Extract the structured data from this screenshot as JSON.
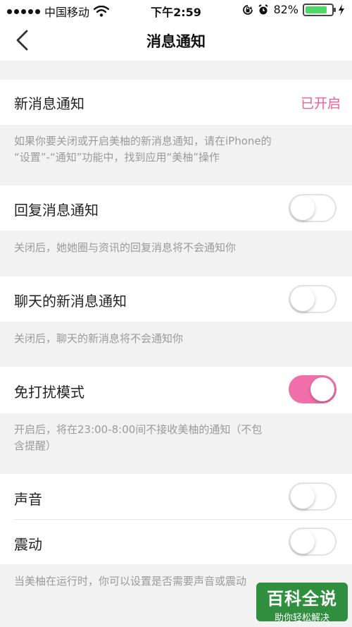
{
  "status_bar": {
    "carrier": "中国移动",
    "time": "下午2:59",
    "battery_percent": "82%",
    "battery_level": 0.82,
    "icons": [
      "signal-dots-icon",
      "wifi-icon",
      "rotation-lock-icon",
      "alarm-icon",
      "battery-icon",
      "charging-bolt-icon"
    ]
  },
  "nav": {
    "title": "消息通知",
    "back_icon": "chevron-left-icon"
  },
  "sections": {
    "new_message": {
      "label": "新消息通知",
      "value": "已开启",
      "desc_line1": "如果你要关闭或开启美柚的新消息通知，请在iPhone的",
      "desc_line2": "“设置”-“通知”功能中，找到应用“美柚”操作"
    },
    "reply": {
      "label": "回复消息通知",
      "on": false,
      "desc": "关闭后，她她圈与资讯的回复消息将不会通知你"
    },
    "chat": {
      "label": "聊天的新消息通知",
      "on": false,
      "desc": "关闭后，聊天的新消息将不会通知你"
    },
    "dnd": {
      "label": "免打扰模式",
      "on": true,
      "desc_line1": "开启后，将在23:00-8:00间不接收美柚的通知（不包",
      "desc_line2": "含提醒）"
    },
    "sound": {
      "label": "声音",
      "on": false
    },
    "vibrate": {
      "label": "震动",
      "on": false
    },
    "footer_desc": "当美柚在运行时，你可以设置是否需要声音或震动"
  },
  "watermark": {
    "main": "百科全说",
    "sub": "助你轻松解决"
  },
  "colors": {
    "accent": "#f06eaa",
    "enabled_text": "#e8609b",
    "background": "#f2f2f2",
    "watermark_bg": "#2f8f3f"
  }
}
